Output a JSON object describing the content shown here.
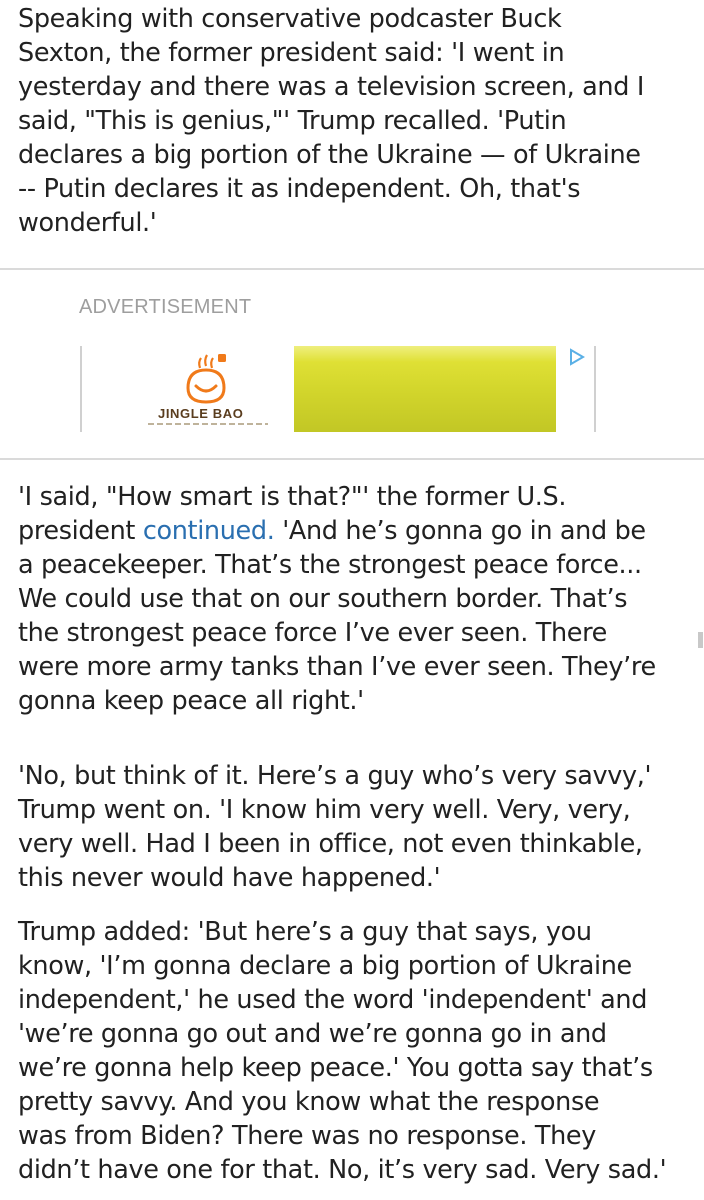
{
  "article": {
    "para1": "Speaking with conservative podcaster Buck\nSexton, the former president said: 'I went in\nyesterday and there was a television screen, and I\nsaid, \"This is genius,\"' Trump recalled. 'Putin\ndeclares a big portion of the Ukraine — of Ukraine\n-- Putin declares it as independent. Oh, that's\nwonderful.'",
    "para2_before_link": "'I said, \"How smart is that?\"' the former U.S.\npresident ",
    "para2_link": "continued.",
    "para2_after_link": " 'And he’s gonna go in and be\na peacekeeper. That’s the strongest peace force...\nWe could use that on our southern border. That’s\nthe strongest peace force I’ve ever seen. There\nwere more army tanks than I’ve ever seen. They’re\ngonna keep peace all right.'",
    "para3": "'No, but think of it. Here’s a guy who’s very savvy,'\nTrump went on. 'I know him very well. Very, very,\nvery well. Had I been in office, not even thinkable,\nthis never would have happened.'",
    "para4": "Trump added: 'But here’s a guy that says, you\nknow, 'I’m gonna declare a big portion of Ukraine\nindependent,' he used the word 'independent' and\n'we’re gonna go out and we’re gonna go in and\nwe’re gonna help keep peace.' You gotta say that’s\npretty savvy. And you know what the response\nwas from Biden? There was no response. They\ndidn’t have one for that. No, it’s very sad. Very sad.'"
  },
  "ad": {
    "label": "ADVERTISEMENT",
    "brand": "JINGLE BAO",
    "logo_icon": "smiling-dumpling-icon",
    "choices_icon": "ad-choices-play-icon",
    "image_color": "#dadc30"
  },
  "colors": {
    "text": "#212121",
    "link": "#2a6fb0",
    "muted": "#9e9e9e",
    "logo_orange": "#f07a1a"
  }
}
